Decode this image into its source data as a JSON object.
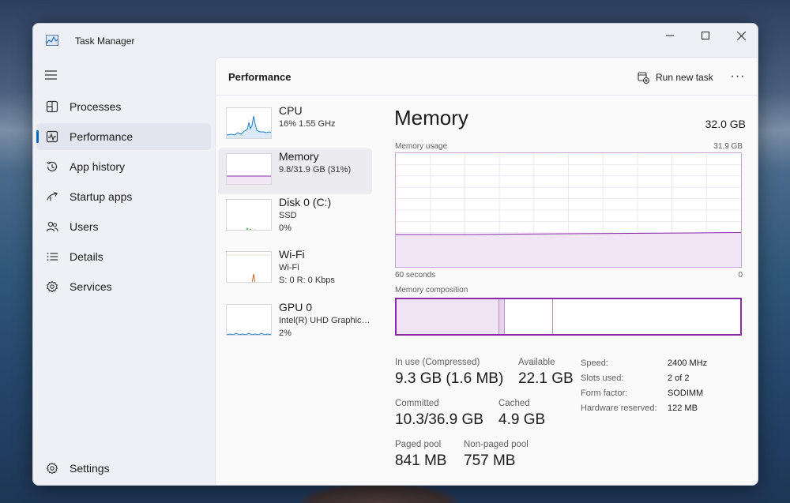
{
  "window": {
    "title": "Task Manager"
  },
  "sidebar": {
    "items": [
      {
        "label": "Processes",
        "icon": "processes-icon"
      },
      {
        "label": "Performance",
        "icon": "performance-icon"
      },
      {
        "label": "App history",
        "icon": "app-history-icon"
      },
      {
        "label": "Startup apps",
        "icon": "startup-apps-icon"
      },
      {
        "label": "Users",
        "icon": "users-icon"
      },
      {
        "label": "Details",
        "icon": "details-icon"
      },
      {
        "label": "Services",
        "icon": "services-icon"
      }
    ],
    "settings_label": "Settings"
  },
  "header": {
    "title": "Performance",
    "run_new_task": "Run new task",
    "more": "···"
  },
  "perf_list": [
    {
      "name": "CPU",
      "sub1": "16%  1.55 GHz",
      "sub2": ""
    },
    {
      "name": "Memory",
      "sub1": "9.8/31.9 GB (31%)",
      "sub2": ""
    },
    {
      "name": "Disk 0 (C:)",
      "sub1": "SSD",
      "sub2": "0%"
    },
    {
      "name": "Wi-Fi",
      "sub1": "Wi-Fi",
      "sub2": "S: 0  R: 0 Kbps"
    },
    {
      "name": "GPU 0",
      "sub1": "Intel(R) UHD Graphics ...",
      "sub2": "2%"
    }
  ],
  "detail": {
    "title": "Memory",
    "total": "32.0 GB",
    "usage_label": "Memory usage",
    "usage_max": "31.9 GB",
    "time_left": "60 seconds",
    "time_right": "0",
    "composition_label": "Memory composition",
    "in_use_fraction": 0.31,
    "stats": {
      "in_use_label": "In use (Compressed)",
      "in_use_value": "9.3 GB (1.6 MB)",
      "available_label": "Available",
      "available_value": "22.1 GB",
      "committed_label": "Committed",
      "committed_value": "10.3/36.9 GB",
      "cached_label": "Cached",
      "cached_value": "4.9 GB",
      "paged_label": "Paged pool",
      "paged_value": "841 MB",
      "nonpaged_label": "Non-paged pool",
      "nonpaged_value": "757 MB"
    },
    "kv": [
      {
        "label": "Speed:",
        "value": "2400 MHz"
      },
      {
        "label": "Slots used:",
        "value": "2 of 2"
      },
      {
        "label": "Form factor:",
        "value": "SODIMM"
      },
      {
        "label": "Hardware reserved:",
        "value": "122 MB"
      }
    ]
  },
  "colors": {
    "accent": "#0067c0",
    "memory": "#8a2aa8",
    "cpu": "#1f7fc4",
    "disk": "#4aa53a",
    "wifi": "#c2662a"
  }
}
